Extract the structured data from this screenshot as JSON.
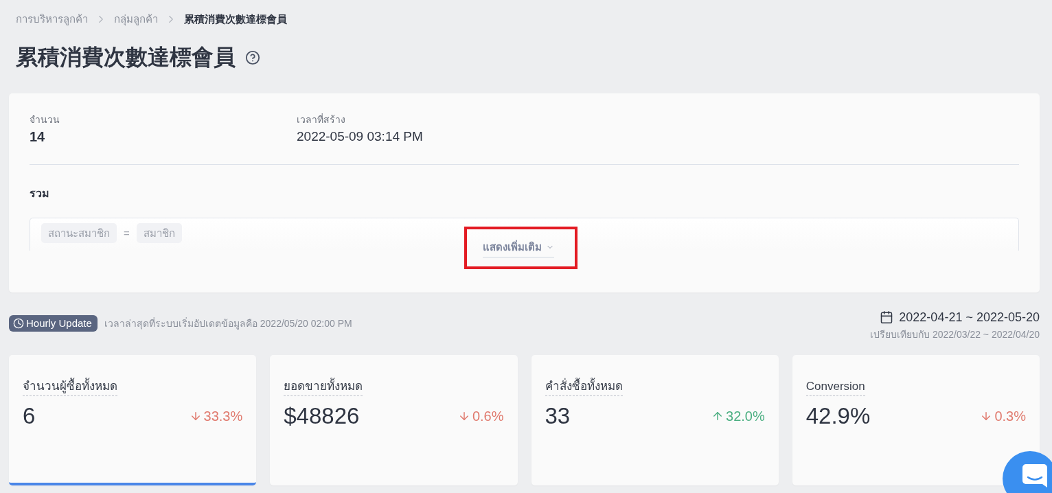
{
  "breadcrumb": [
    {
      "label": "การบริหารลูกค้า",
      "current": false
    },
    {
      "label": "กลุ่มลูกค้า",
      "current": false
    },
    {
      "label": "累積消費次數達標會員",
      "current": true
    }
  ],
  "page_title": "累積消費次數達標會員",
  "summary": {
    "fields": [
      {
        "label": "จำนวน",
        "value": "14",
        "kind": "count"
      },
      {
        "label": "เวลาที่สร้าง",
        "value": "2022-05-09 03:14 PM",
        "kind": "time"
      }
    ],
    "conditions": {
      "title": "รวม",
      "rules": [
        {
          "field": "สถานะสมาชิก",
          "operator": "=",
          "value": "สมาชิก"
        }
      ],
      "show_more": {
        "label": "แสดงเพิ่มเติม",
        "highlighted": true
      }
    }
  },
  "update": {
    "badge": "Hourly Update",
    "note": "เวลาล่าสุดที่ระบบเริ่มอัปเดตข้อมูลคือ 2022/05/20 02:00 PM"
  },
  "date_range": {
    "range": "2022-04-21 ~ 2022-05-20",
    "compare": "เปรียบเทียบกับ 2022/03/22 ~ 2022/04/20"
  },
  "metrics": [
    {
      "label": "จำนวนผู้ซื้อทั้งหมด",
      "value": "6",
      "change": "33.3%",
      "kind": "down",
      "selected": true
    },
    {
      "label": "ยอดขายทั้งหมด",
      "value": "$48826",
      "change": "0.6%",
      "kind": "down",
      "selected": false
    },
    {
      "label": "คำสั่งซื้อทั้งหมด",
      "value": "33",
      "change": "32.0%",
      "kind": "up",
      "selected": false
    },
    {
      "label": "Conversion",
      "value": "42.9%",
      "change": "0.3%",
      "kind": "down",
      "selected": false
    }
  ]
}
